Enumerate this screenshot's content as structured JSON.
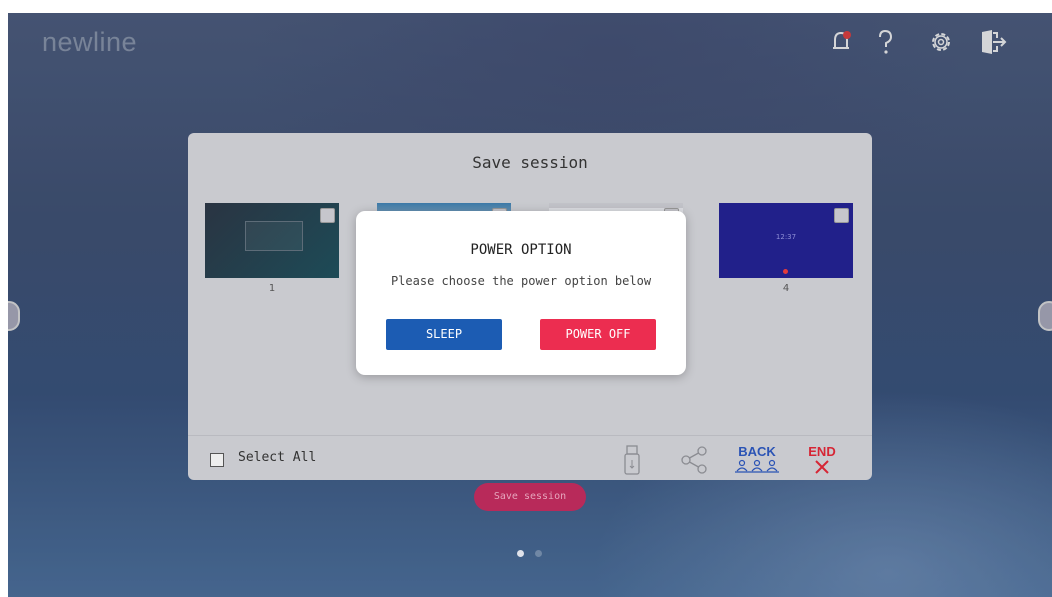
{
  "app": {
    "logo_text": "newline"
  },
  "topbar": {
    "icons": [
      "notification-bell-icon",
      "help-question-icon",
      "settings-gear-icon",
      "exit-door-icon"
    ],
    "notification_color": "#e23b3b"
  },
  "session_dialog": {
    "title": "Save session",
    "thumbnails": [
      {
        "label": "1"
      },
      {
        "label": ""
      },
      {
        "label": ""
      },
      {
        "label": "4",
        "time_text": "12:37"
      }
    ],
    "footer": {
      "select_all_label": "Select All",
      "back_label": "BACK",
      "end_label": "END"
    }
  },
  "save_session_button": {
    "label": "Save session"
  },
  "pagination": {
    "pages": 2,
    "active_page": 1
  },
  "power_dialog": {
    "title": "POWER OPTION",
    "subtitle": "Please choose the power option below",
    "sleep_label": "SLEEP",
    "power_off_label": "POWER OFF",
    "sleep_color": "#1c5cb3",
    "power_off_color": "#ec2d50"
  }
}
